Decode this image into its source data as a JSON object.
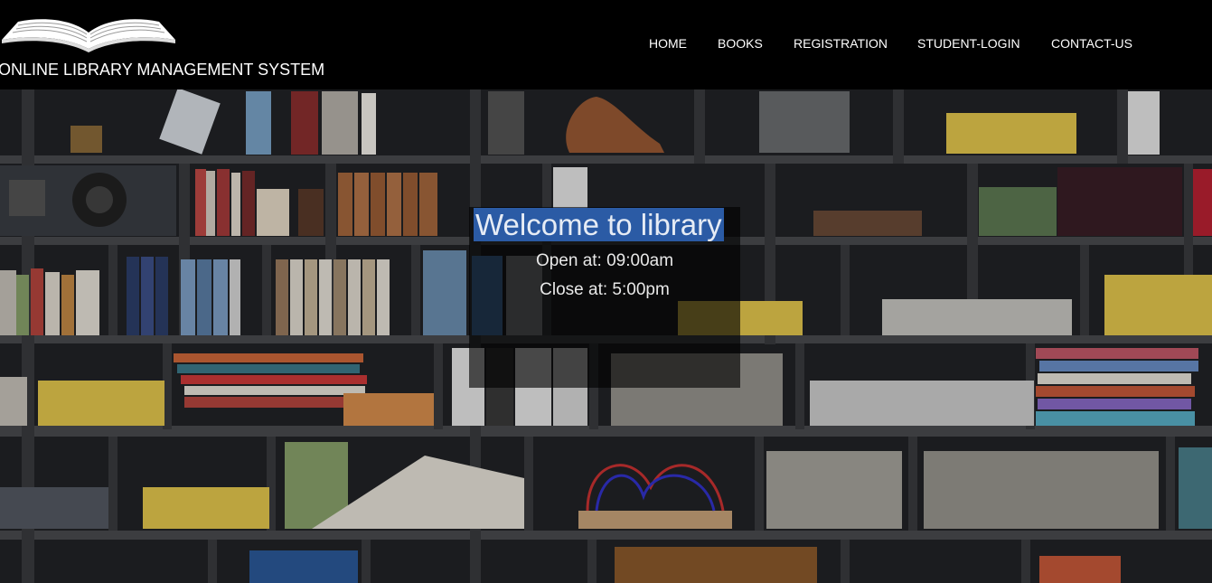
{
  "site": {
    "title": "ONLINE LIBRARY MANAGEMENT SYSTEM",
    "logo_icon": "open-book-icon"
  },
  "nav": {
    "items": [
      {
        "label": "HOME"
      },
      {
        "label": "BOOKS"
      },
      {
        "label": "REGISTRATION"
      },
      {
        "label": "STUDENT-LOGIN"
      },
      {
        "label": "CONTACT-US"
      }
    ]
  },
  "hero": {
    "welcome": "Welcome to library",
    "open": "Open at: 09:00am",
    "close": "Close at: 5:00pm",
    "background": "bookshelf-photo",
    "highlight_color": "#2b5ba5"
  }
}
